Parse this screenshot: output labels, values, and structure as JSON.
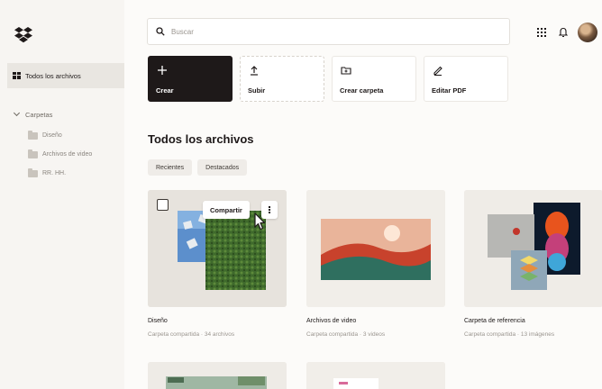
{
  "search": {
    "placeholder": "Buscar"
  },
  "sidebar": {
    "all_files": "Todos los archivos",
    "section": "Carpetas",
    "folders": [
      {
        "label": "Diseño"
      },
      {
        "label": "Archivos de video"
      },
      {
        "label": "RR. HH."
      }
    ]
  },
  "actions": [
    {
      "label": "Crear",
      "icon": "plus-icon"
    },
    {
      "label": "Subir",
      "icon": "upload-icon"
    },
    {
      "label": "Crear carpeta",
      "icon": "folder-plus-icon"
    },
    {
      "label": "Editar PDF",
      "icon": "pen-icon"
    }
  ],
  "main": {
    "title": "Todos los archivos",
    "filters": [
      "Recientes",
      "Destacados"
    ]
  },
  "cards": [
    {
      "name": "Diseño",
      "meta": "Carpeta compartida · 34 archivos",
      "share_label": "Compartir"
    },
    {
      "name": "Archivos de video",
      "meta": "Carpeta compartida · 3 videos"
    },
    {
      "name": "Carpeta de referencia",
      "meta": "Carpeta compartida · 13 imágenes"
    }
  ],
  "colors": {
    "accent": "#1e1919",
    "background": "#f7f5f2"
  }
}
